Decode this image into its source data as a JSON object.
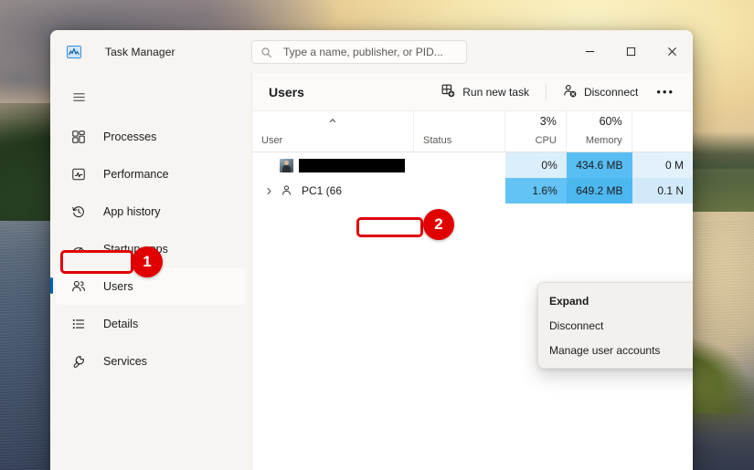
{
  "window": {
    "app_icon": "task-manager-icon",
    "title": "Task Manager",
    "minimize": "–",
    "maximize": "☐",
    "close": "✕"
  },
  "search": {
    "icon": "search-icon",
    "placeholder": "Type a name, publisher, or PID..."
  },
  "sidebar": {
    "hamburger": "hamburger-icon",
    "items": [
      {
        "label": "Processes",
        "icon": "processes-icon",
        "selected": false
      },
      {
        "label": "Performance",
        "icon": "performance-icon",
        "selected": false
      },
      {
        "label": "App history",
        "icon": "app-history-icon",
        "selected": false
      },
      {
        "label": "Startup apps",
        "icon": "startup-apps-icon",
        "selected": false
      },
      {
        "label": "Users",
        "icon": "users-icon",
        "selected": true
      },
      {
        "label": "Details",
        "icon": "details-icon",
        "selected": false
      },
      {
        "label": "Services",
        "icon": "services-icon",
        "selected": false
      }
    ]
  },
  "commandbar": {
    "page_title": "Users",
    "run_new_task": "Run new task",
    "disconnect": "Disconnect",
    "more": "•••"
  },
  "table": {
    "sort_caret": "⌃",
    "columns": [
      {
        "key": "user",
        "label": "User",
        "pct": "",
        "sorted": true
      },
      {
        "key": "status",
        "label": "Status",
        "pct": "",
        "sorted": false
      },
      {
        "key": "cpu",
        "label": "CPU",
        "pct": "3%",
        "sorted": false
      },
      {
        "key": "memory",
        "label": "Memory",
        "pct": "60%",
        "sorted": false
      },
      {
        "key": "disk",
        "label": "",
        "pct": "",
        "sorted": false
      }
    ],
    "rows": [
      {
        "user_label": "",
        "redacted": true,
        "has_avatar": true,
        "has_expander": false,
        "status": "",
        "cpu": "0%",
        "memory": "434.6 MB",
        "disk": "0 M"
      },
      {
        "user_label": "PC1 (66",
        "redacted": false,
        "has_avatar": false,
        "has_expander": true,
        "status": "",
        "cpu": "1.6%",
        "memory": "649.2 MB",
        "disk": "0.1 N"
      }
    ]
  },
  "context_menu": {
    "items": [
      {
        "label": "Expand",
        "bold": true
      },
      {
        "label": "Disconnect",
        "bold": false
      },
      {
        "label": "Manage user accounts",
        "bold": false
      }
    ]
  },
  "annotations": {
    "badge_1": "1",
    "badge_2": "2",
    "accent": "#e00000"
  },
  "colors": {
    "selection_accent": "#005fb8",
    "heat_cpu_row1": "#dbeefb",
    "heat_cpu_row2": "#63c3f5",
    "heat_mem_row1": "#58bdf2",
    "heat_mem_row2": "#4db8f0",
    "heat_disk_row1": "#e2f1fc",
    "heat_disk_row2": "#d2e9fa"
  }
}
